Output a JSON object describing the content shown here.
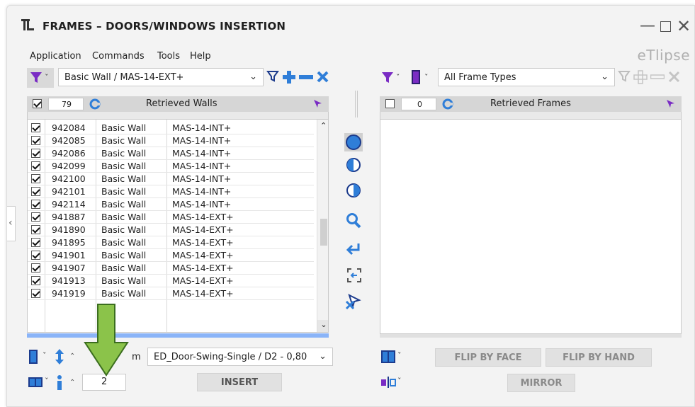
{
  "window": {
    "title": "FRAMES – DOORS/WINDOWS INSERTION",
    "brand": "eTlipse",
    "controls": [
      "minimize",
      "maximize",
      "close"
    ]
  },
  "menu": [
    "Application",
    "Commands",
    "Tools",
    "Help"
  ],
  "left": {
    "filter_combo": "Basic Wall / MAS-14-EXT+",
    "count": "79",
    "header_label": "Retrieved Walls",
    "rows": [
      {
        "id": "942084",
        "type": "Basic Wall",
        "name": "MAS-14-INT+"
      },
      {
        "id": "942085",
        "type": "Basic Wall",
        "name": "MAS-14-INT+"
      },
      {
        "id": "942086",
        "type": "Basic Wall",
        "name": "MAS-14-INT+"
      },
      {
        "id": "942099",
        "type": "Basic Wall",
        "name": "MAS-14-INT+"
      },
      {
        "id": "942100",
        "type": "Basic Wall",
        "name": "MAS-14-INT+"
      },
      {
        "id": "942101",
        "type": "Basic Wall",
        "name": "MAS-14-INT+"
      },
      {
        "id": "942114",
        "type": "Basic Wall",
        "name": "MAS-14-INT+"
      },
      {
        "id": "941887",
        "type": "Basic Wall",
        "name": "MAS-14-EXT+"
      },
      {
        "id": "941890",
        "type": "Basic Wall",
        "name": "MAS-14-EXT+"
      },
      {
        "id": "941895",
        "type": "Basic Wall",
        "name": "MAS-14-EXT+"
      },
      {
        "id": "941901",
        "type": "Basic Wall",
        "name": "MAS-14-EXT+"
      },
      {
        "id": "941907",
        "type": "Basic Wall",
        "name": "MAS-14-EXT+"
      },
      {
        "id": "941913",
        "type": "Basic Wall",
        "name": "MAS-14-EXT+"
      },
      {
        "id": "941919",
        "type": "Basic Wall",
        "name": "MAS-14-EXT+"
      }
    ],
    "unit": "m",
    "family_combo": "ED_Door-Swing-Single / D2 - 0,80",
    "count_input": "2",
    "insert_label": "INSERT"
  },
  "right": {
    "filter_combo": "All Frame Types",
    "count": "0",
    "header_label": "Retrieved Frames",
    "flip_face_label": "FLIP BY FACE",
    "flip_hand_label": "FLIP BY HAND",
    "mirror_label": "MIRROR"
  },
  "colors": {
    "accent_blue": "#2f7ed8",
    "funnel_purple": "#7a2cc4",
    "dark_blue": "#1c3b8c",
    "arrow_green": "#8bc34a"
  }
}
